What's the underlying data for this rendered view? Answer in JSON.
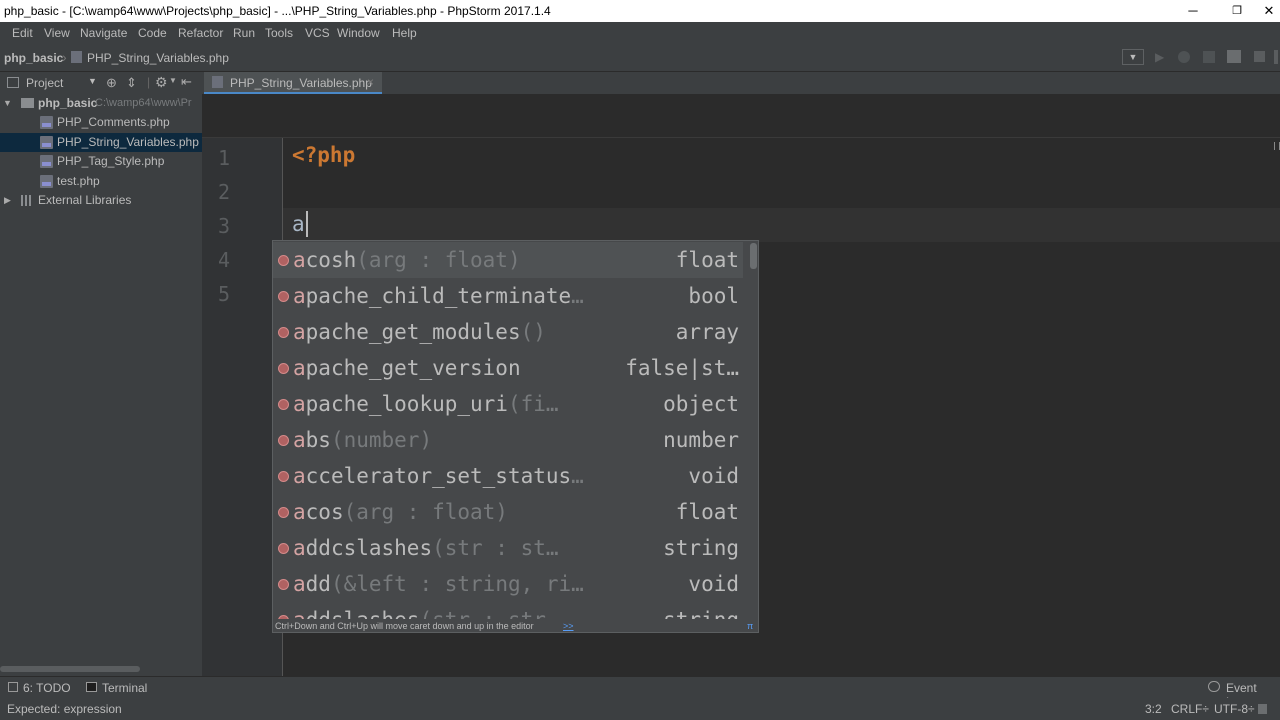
{
  "window": {
    "title": "php_basic - [C:\\wamp64\\www\\Projects\\php_basic] - ...\\PHP_String_Variables.php - PhpStorm 2017.1.4",
    "minimize": "─",
    "maximize": "❐",
    "close": "✕"
  },
  "menu": [
    "Edit",
    "View",
    "Navigate",
    "Code",
    "Refactor",
    "Run",
    "Tools",
    "VCS",
    "Window",
    "Help"
  ],
  "navbar": {
    "project": "php_basic",
    "file": "PHP_String_Variables.php"
  },
  "project_panel": {
    "title": "Project",
    "root_name": "php_basic",
    "root_path": "C:\\wamp64\\www\\Pr",
    "files": [
      "PHP_Comments.php",
      "PHP_String_Variables.php",
      "PHP_Tag_Style.php",
      "test.php"
    ],
    "selected_index": 1,
    "external": "External Libraries"
  },
  "editor": {
    "tab_label": "PHP_String_Variables.php",
    "tab_close": "×",
    "line_numbers": [
      "1",
      "2",
      "3",
      "4",
      "5"
    ],
    "line1": "<?php",
    "line3": "a"
  },
  "completion": {
    "items": [
      {
        "match": "a",
        "rest": "cosh",
        "params": "(arg : float)",
        "type": "float"
      },
      {
        "match": "a",
        "rest": "pache_child_terminate",
        "params": "…",
        "type": "bool"
      },
      {
        "match": "a",
        "rest": "pache_get_modules",
        "params": "()",
        "type": "array"
      },
      {
        "match": "a",
        "rest": "pache_get_version",
        "params": "",
        "type": "false|st…"
      },
      {
        "match": "a",
        "rest": "pache_lookup_uri",
        "params": "(fi…",
        "type": "object"
      },
      {
        "match": "a",
        "rest": "bs",
        "params": "(number)",
        "type": "number"
      },
      {
        "match": "a",
        "rest": "ccelerator_set_status",
        "params": "…",
        "type": "void"
      },
      {
        "match": "a",
        "rest": "cos",
        "params": "(arg : float)",
        "type": "float"
      },
      {
        "match": "a",
        "rest": "ddcslashes",
        "params": "(str : st…",
        "type": "string"
      },
      {
        "match": "a",
        "rest": "dd",
        "params": "(&left : string, ri…",
        "type": "void"
      },
      {
        "match": "a",
        "rest": "ddslashes",
        "params": "(str : str",
        "type": "string"
      }
    ],
    "footer": "Ctrl+Down and Ctrl+Up will move caret down and up in the editor",
    "footer_link": ">>",
    "footer_pi": "π"
  },
  "bottom_tools": {
    "todo": "6: TODO",
    "terminal": "Terminal",
    "event_log": "Event Log"
  },
  "status": {
    "message": "Expected: expression",
    "position": "3:2",
    "line_sep": "CRLF÷",
    "encoding": "UTF-8÷"
  }
}
